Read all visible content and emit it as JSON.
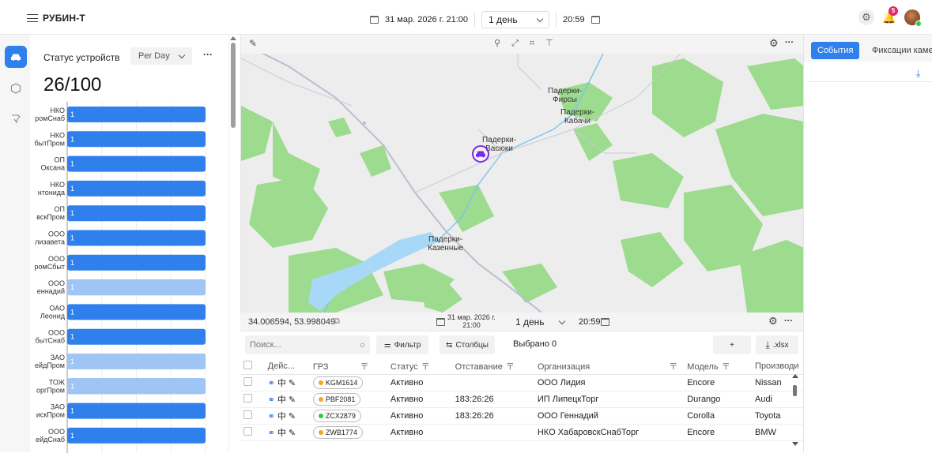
{
  "app": {
    "title": "РУБИН-Т"
  },
  "top": {
    "date": "31 мар. 2026 г. 21:00",
    "period": "1 день",
    "time": "20:59",
    "notifications": "5"
  },
  "nav": [
    {
      "icon": "car-icon"
    },
    {
      "icon": "hexagon-icon"
    },
    {
      "icon": "pin-icon"
    }
  ],
  "status": {
    "title": "Статус устройств",
    "period": "Per Day",
    "more": "···",
    "value": "26/100"
  },
  "chart_data": {
    "type": "bar",
    "orientation": "horizontal",
    "categories": [
      [
        "НКО",
        "ромСнаб"
      ],
      [
        "НКО",
        "бытПром"
      ],
      [
        "ОП",
        "Оксана"
      ],
      [
        "НКО",
        "нтонида"
      ],
      [
        "ОП",
        "вскПром"
      ],
      [
        "ООО",
        "лизавета"
      ],
      [
        "ООО",
        "ромСбыт"
      ],
      [
        "ООО",
        "еннадий"
      ],
      [
        "ОАО",
        "Леонид"
      ],
      [
        "ООО",
        "бытСнаб"
      ],
      [
        "ЗАО",
        "ейдПром"
      ],
      [
        "ТОЖ",
        "оргПром"
      ],
      [
        "ЗАО",
        "искПром"
      ],
      [
        "ООО",
        "ейдСнаб"
      ]
    ],
    "series": [
      {
        "values": [
          1,
          1,
          1,
          1,
          1,
          1,
          1,
          1,
          1,
          1,
          1,
          1,
          1,
          1
        ]
      },
      {
        "values": [
          0,
          0,
          0,
          0,
          0,
          0,
          0,
          1,
          0,
          0,
          1,
          1,
          0,
          0
        ]
      }
    ],
    "series_colors": [
      "#2f80ed",
      "#9fc5f5"
    ],
    "xlim": [
      0,
      1
    ]
  },
  "map": {
    "more": "···",
    "places": [
      {
        "lines": [
          "Падерки-",
          "Фирсы"
        ]
      },
      {
        "lines": [
          "Падерки-",
          "Кабачи"
        ]
      },
      {
        "lines": [
          "Падерки-",
          "Васюки"
        ]
      },
      {
        "lines": [
          "Падерки-",
          "Казенные"
        ]
      }
    ],
    "coords": "34.006594, 53.998049",
    "date_lines": [
      "31 мар. 2026 г.",
      "21:00"
    ],
    "period": "1 день",
    "time": "20:59"
  },
  "table": {
    "search_placeholder": "Поиск...",
    "filter": "Фильтр",
    "columns_btn": "Столбцы",
    "selected": "Выбрано 0",
    "add": "+",
    "export": ".xlsx",
    "headers": [
      "Дейс...",
      "ГРЗ",
      "Статус",
      "Отставание",
      "Организация",
      "Модель",
      "Производи"
    ],
    "rows": [
      {
        "plate": "KGM1614",
        "dot": "#f5a623",
        "status": "Активно",
        "lag": "",
        "org": "ООО Лидия",
        "model": "Encore",
        "maker": "Nissan"
      },
      {
        "plate": "PBF2081",
        "dot": "#f5a623",
        "status": "Активно",
        "lag": "183:26:26",
        "org": "ИП ЛипецкТорг",
        "model": "Durango",
        "maker": "Audi"
      },
      {
        "plate": "ZCX2879",
        "dot": "#2ecc40",
        "status": "Активно",
        "lag": "183:26:26",
        "org": "ООО Геннадий",
        "model": "Corolla",
        "maker": "Toyota"
      },
      {
        "plate": "ZWB1774",
        "dot": "#f5a623",
        "status": "Активно",
        "lag": "",
        "org": "НКО ХабаровскСнабТорг",
        "model": "Encore",
        "maker": "BMW"
      }
    ]
  },
  "right": {
    "tab_events": "События",
    "tab_camera": "Фиксации каме"
  }
}
